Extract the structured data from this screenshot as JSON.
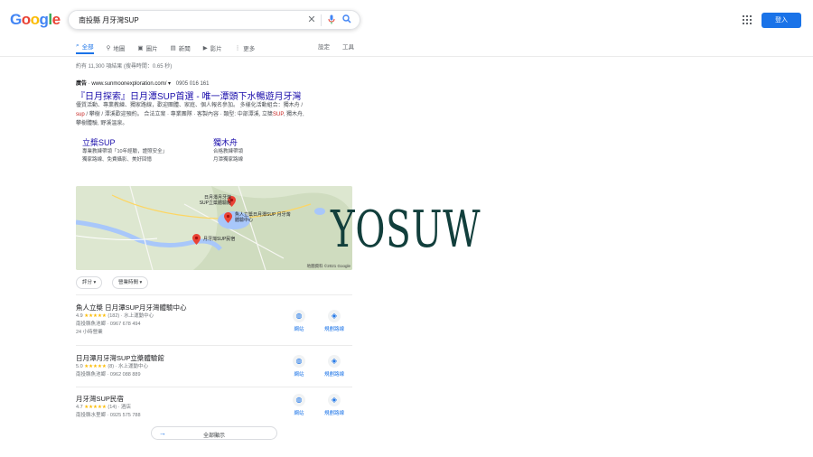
{
  "logo": {
    "text": "Google"
  },
  "search": {
    "query": "南投縣 月牙灣SUP"
  },
  "header": {
    "signin_label": "登入"
  },
  "tabs": [
    {
      "label": "全部",
      "icon": "search-icon"
    },
    {
      "label": "地圖",
      "icon": "map-pin-icon"
    },
    {
      "label": "圖片",
      "icon": "image-icon"
    },
    {
      "label": "新聞",
      "icon": "news-icon"
    },
    {
      "label": "影片",
      "icon": "video-icon"
    },
    {
      "label": "更多",
      "icon": "more-icon"
    }
  ],
  "tabs_right": {
    "settings": "設定",
    "tools": "工具"
  },
  "stats": "約有 11,300 項結果 (搜尋時間：0.65 秒)",
  "ad": {
    "badge": "廣告",
    "url": "· www.sunmoonexploration.com/ ▾",
    "phone": "0905 016 161",
    "title": "『日月探索』日月潭SUP首選 - 唯一潭頭下水暢遊月牙灣",
    "desc_1": "優質活動、專業教練、獨家路線，歡迎團體、家庭、個人報名參加。 多樣化活動組合：獨木舟 /",
    "desc_2_pre": "sup",
    "desc_2_post": " / 攀樹 / 潭溪歡迎預約。 合法立案 · 專業團隊 · 客製內容 · 類型: 中部潭溪, 立槳",
    "desc_2_em": "SUP",
    "desc_2_end": ", 獨木舟,",
    "desc_3": "攀樹體驗, 野溪溫泉。",
    "sitelinks": [
      {
        "title": "立槳SUP",
        "line1": "專業教練帶領「10年經驗，證照安全」",
        "line2": "獨家路線、免費攝影、美好回憶"
      },
      {
        "title": "獨木舟",
        "line1": "合格教練帶領",
        "line2": "月潭獨家路線"
      }
    ]
  },
  "map": {
    "credit": "地圖資料 ©2021 Google",
    "pins": [
      {
        "label": "日月潭月牙灣 SUP立槳體驗館"
      },
      {
        "label": "魚人立槳日月潭SUP 月牙灣體驗中心"
      },
      {
        "label": "月牙灣SUP民宿"
      }
    ]
  },
  "filters": [
    "評分",
    "營業時間"
  ],
  "results": [
    {
      "name": "魚人立槳 日月潭SUP月牙灣體驗中心",
      "rating": "4.9",
      "stars": "★★★★★",
      "count": "(182)",
      "category": "· 水上運動中心",
      "address": "南投縣魚池鄉 · 0967 678 494",
      "extra": "24 小時營業"
    },
    {
      "name": "日月潭月牙灣SUP立槳體驗館",
      "rating": "5.0",
      "stars": "★★★★★",
      "count": "(8)",
      "category": "· 水上運動中心",
      "address": "南投縣魚池鄉 · 0962 088 889",
      "extra": ""
    },
    {
      "name": "月牙灣SUP民宿",
      "rating": "4.7",
      "stars": "★★★★★",
      "count": "(14)",
      "category": "· 酒店",
      "address": "南投縣水里鄉 · 0925 575 788",
      "extra": ""
    }
  ],
  "result_actions": {
    "website": "網站",
    "directions": "規劃路線"
  },
  "more_places": "全部顯示",
  "watermark": "YOSUW",
  "colors": {
    "link": "#1a0dab",
    "accent": "#1a73e8",
    "star": "#fbbc04"
  }
}
